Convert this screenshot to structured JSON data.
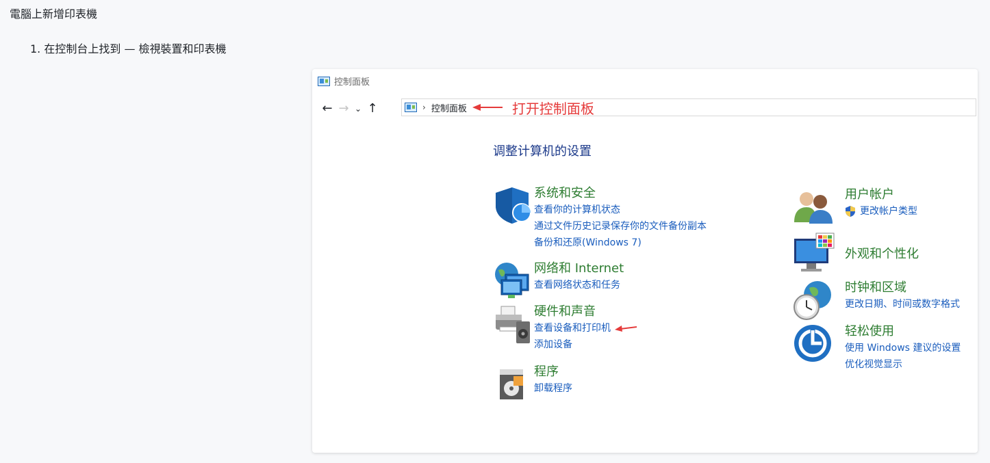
{
  "doc": {
    "title": "電腦上新增印表機",
    "step": "1. 在控制台上找到 — 檢視裝置和印表機"
  },
  "window": {
    "title": "控制面板",
    "nav": {
      "back": "←",
      "forward": "→",
      "recent": "⌄",
      "up": "↑"
    },
    "address": {
      "separator": "›",
      "location": "控制面板"
    },
    "annotation": "打开控制面板"
  },
  "heading": "调整计算机的设置",
  "categories_left": [
    {
      "title": "系统和安全",
      "links": [
        "查看你的计算机状态",
        "通过文件历史记录保存你的文件备份副本",
        "备份和还原(Windows 7)"
      ]
    },
    {
      "title": "网络和 Internet",
      "links": [
        "查看网络状态和任务"
      ]
    },
    {
      "title": "硬件和声音",
      "links": [
        "查看设备和打印机",
        "添加设备"
      ]
    },
    {
      "title": "程序",
      "links": [
        "卸载程序"
      ]
    }
  ],
  "categories_right": [
    {
      "title": "用户帐户",
      "links": [
        "更改帐户类型"
      ]
    },
    {
      "title": "外观和个性化",
      "links": []
    },
    {
      "title": "时钟和区域",
      "links": [
        "更改日期、时间或数字格式"
      ]
    },
    {
      "title": "轻松使用",
      "links": [
        "使用 Windows 建议的设置",
        "优化视觉显示"
      ]
    }
  ],
  "colors": {
    "annotation": "#e53b3b",
    "category_title": "#2e7d32",
    "link": "#1a5dbd",
    "heading": "#1c3a8a"
  }
}
